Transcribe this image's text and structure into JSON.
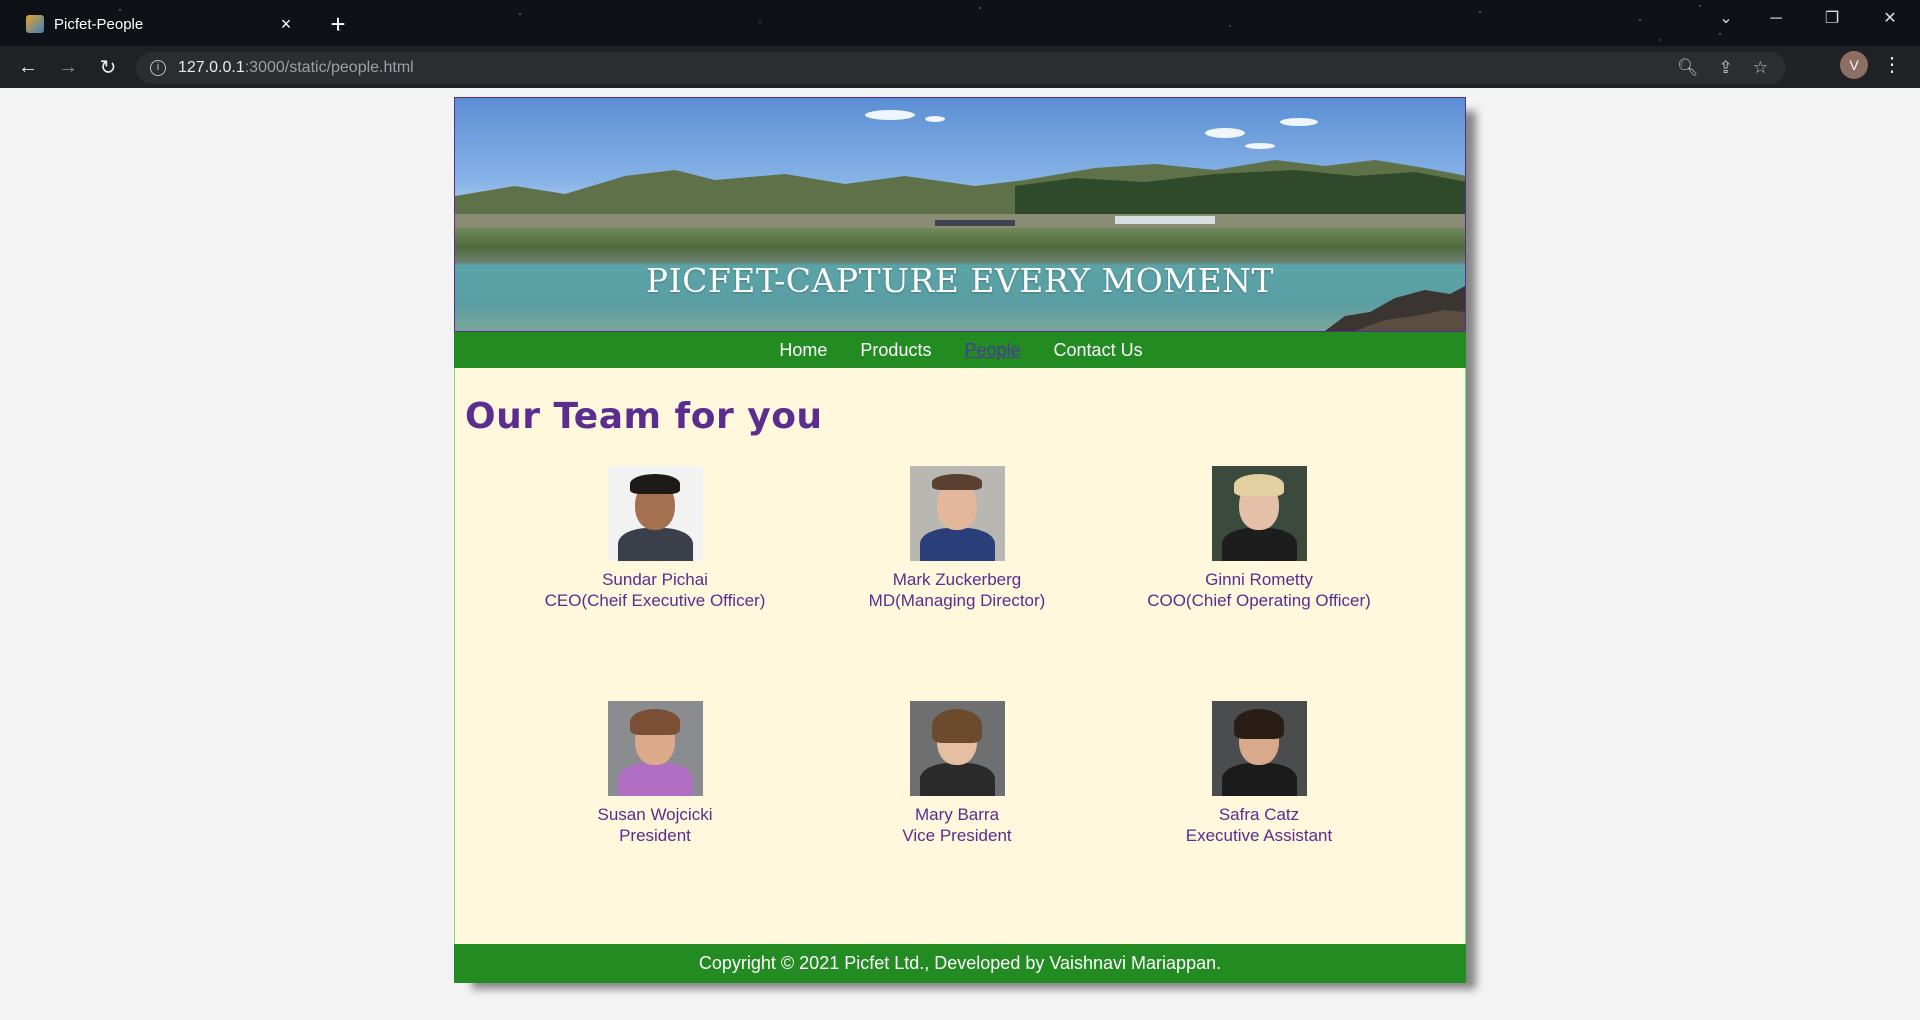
{
  "browser": {
    "tab_title": "Picfet-People",
    "tab_close": "×",
    "new_tab": "+",
    "url_host": "127.0.0.1",
    "url_path": ":3000/static/people.html",
    "avatar_letter": "V"
  },
  "banner": {
    "title": "PICFET-CAPTURE EVERY MOMENT"
  },
  "nav": {
    "items": [
      {
        "label": "Home"
      },
      {
        "label": "Products"
      },
      {
        "label": "People"
      },
      {
        "label": "Contact Us"
      }
    ],
    "active": "People"
  },
  "main": {
    "heading": "Our Team for you",
    "team": [
      {
        "name": "Sundar Pichai",
        "role": "CEO(Cheif Executive Officer)"
      },
      {
        "name": "Mark Zuckerberg",
        "role": "MD(Managing Director)"
      },
      {
        "name": "Ginni Rometty",
        "role": "COO(Chief Operating Officer)"
      },
      {
        "name": "Susan Wojcicki",
        "role": "President"
      },
      {
        "name": "Mary Barra",
        "role": "Vice President"
      },
      {
        "name": "Safra Catz",
        "role": "Executive Assistant"
      }
    ]
  },
  "footer": {
    "text": "Copyright © 2021 Picfet Ltd., Developed by Vaishnavi Mariappan."
  },
  "colors": {
    "nav_green": "#228b22",
    "heading_purple": "#5b2d8e",
    "content_bg": "#fff8dc"
  }
}
